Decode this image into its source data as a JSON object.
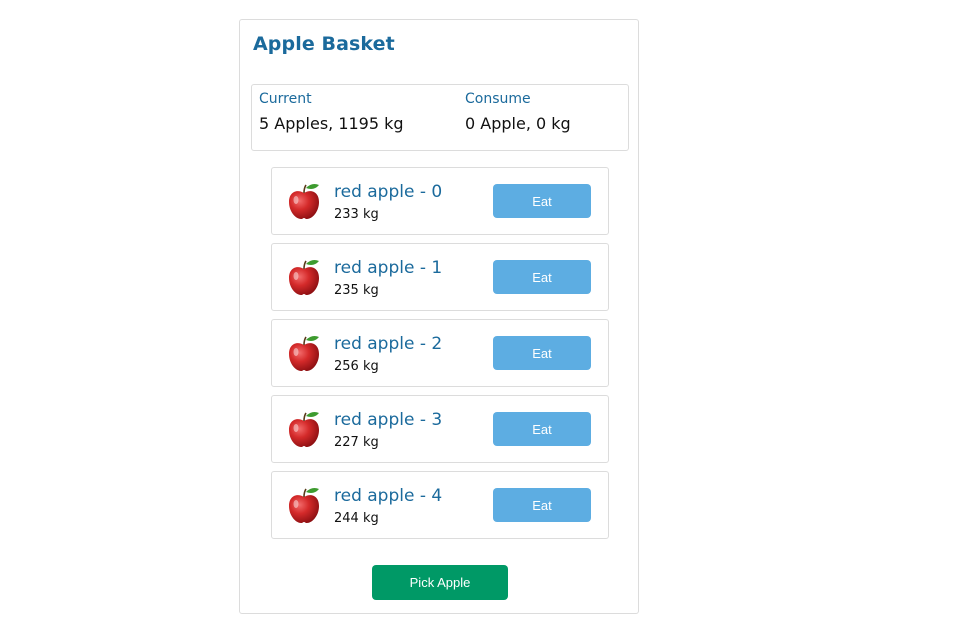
{
  "basket": {
    "title": "Apple Basket"
  },
  "stats": {
    "current_label": "Current",
    "current_value": "5 Apples, 1195 kg",
    "consume_label": "Consume",
    "consume_value": "0 Apple, 0 kg"
  },
  "apples": [
    {
      "name": "red apple - 0",
      "weight": "233 kg",
      "eat_label": "Eat",
      "icon": "apple-icon"
    },
    {
      "name": "red apple - 1",
      "weight": "235 kg",
      "eat_label": "Eat",
      "icon": "apple-icon"
    },
    {
      "name": "red apple - 2",
      "weight": "256 kg",
      "eat_label": "Eat",
      "icon": "apple-icon"
    },
    {
      "name": "red apple - 3",
      "weight": "227 kg",
      "eat_label": "Eat",
      "icon": "apple-icon"
    },
    {
      "name": "red apple - 4",
      "weight": "244 kg",
      "eat_label": "Eat",
      "icon": "apple-icon"
    }
  ],
  "actions": {
    "pick_label": "Pick Apple"
  },
  "colors": {
    "accent_text": "#1b6a9c",
    "eat_button": "#5dade2",
    "pick_button": "#009966",
    "border": "#dcdcdc"
  }
}
